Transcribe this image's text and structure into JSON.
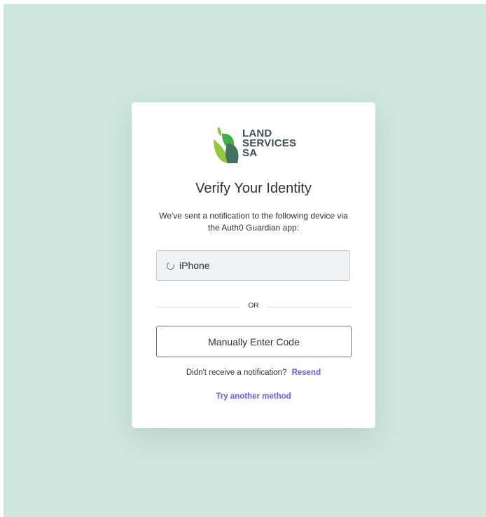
{
  "page": {
    "background_color": "#cde7df"
  },
  "logo": {
    "line1": "LAND",
    "line2": "SERVICES",
    "line3": "SA",
    "icon": "land-services-sa-leaf-icon"
  },
  "prompt": {
    "title": "Verify Your Identity",
    "description": "We've sent a notification to the following device via the Auth0 Guardian app:"
  },
  "device": {
    "name": "iPhone",
    "icon": "loading-spinner-icon"
  },
  "divider": {
    "label": "OR"
  },
  "actions": {
    "manual_code_label": "Manually Enter Code",
    "not_received_text": "Didn't receive a notification?",
    "resend_label": "Resend",
    "try_another_label": "Try another method"
  },
  "colors": {
    "accent": "#635dff",
    "text": "#2d333a",
    "logo_text": "#3f4f5a"
  }
}
